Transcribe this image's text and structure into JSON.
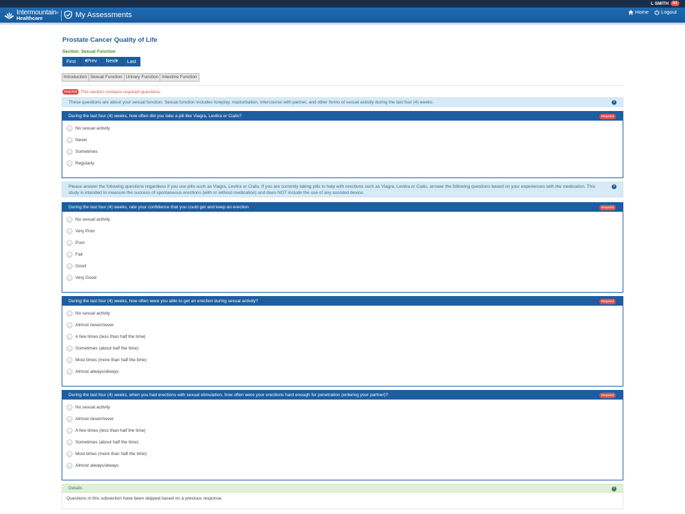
{
  "topbar": {
    "user": "L SMITH",
    "badge": "0/1"
  },
  "header": {
    "brand_line1": "Intermountain",
    "brand_tm": "®",
    "brand_line2": "Healthcare",
    "app_title": "My Assessments",
    "nav": {
      "home": "Home",
      "logout": "Logout"
    }
  },
  "page": {
    "title": "Prostate Cancer Quality of Life",
    "section": "Section: Sexual Function",
    "pager": {
      "first": "First",
      "prev": "Prev",
      "next": "Next",
      "last": "Last"
    },
    "tabs": [
      "Introduction",
      "Sexual Function",
      "Urinary Function",
      "Intestine Function"
    ],
    "required_badge": "Required",
    "required_note": "This section contains required questions."
  },
  "info1": "These questions are about your sexual function. Sexual function includes foreplay, masturbation, intercourse with partner, and other forms of sexual activity during the last four (4) weeks.",
  "info2": "Please answer the following questions regardless if you use pills such as Viagra, Levitra or Cialis. If you are currently taking pills to help with erections such as Viagra, Levitra or Cialis, answer the following questions based on your experiences with the medication. This study is intended to measure the success of spontaneous erections (with or without medication) and does NOT include the use of any assisted device.",
  "questions": [
    {
      "text": "During the last four (4) weeks, how often did you take a pill like Viagra, Levitra or Cialis?",
      "options": [
        "No sexual activity",
        "Never",
        "Sometimes",
        "Regularly"
      ]
    },
    {
      "text": "During the last four (4) weeks, rate your confidence that you could get and keep an erection",
      "options": [
        "No sexual activity",
        "Very Poor",
        "Poor",
        "Fair",
        "Good",
        "Very Good"
      ]
    },
    {
      "text": "During the last four (4) weeks, how often were you able to get an erection during sexual activity?",
      "options": [
        "No sexual activity",
        "Almost never/never",
        "A few times (less than half the time)",
        "Sometimes (about half the time)",
        "Most times (more than half the time)",
        "Almost always/always"
      ]
    },
    {
      "text": "During the last four (4) weeks, when you had erections with sexual stimulation, how often were your erections hard enough for penetration (entering your partner)?",
      "options": [
        "No sexual activity",
        "Almost never/never",
        "A few times (less than half the time)",
        "Sometimes (about half the time)",
        "Most times (more than half the time)",
        "Almost always/always"
      ]
    }
  ],
  "details": {
    "title": "Details",
    "body": "Questions in this subsection have been skipped based on a previous response."
  },
  "colors": {
    "primary": "#1c5ea0",
    "required": "#d9534f",
    "info_bg": "#d8eaf5",
    "success_bg": "#dff0d8"
  }
}
